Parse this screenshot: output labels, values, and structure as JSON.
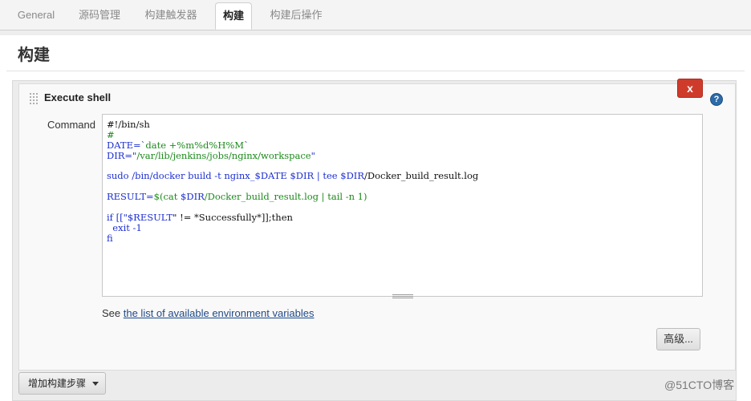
{
  "tabs": [
    {
      "label": "General"
    },
    {
      "label": "源码管理"
    },
    {
      "label": "构建触发器"
    },
    {
      "label": "构建"
    },
    {
      "label": "构建后操作"
    }
  ],
  "section": {
    "title": "构建"
  },
  "build_step": {
    "title": "Execute shell",
    "delete_label": "x",
    "help_label": "?",
    "command_label": "Command",
    "code": [
      "#!/bin/sh",
      "#",
      [
        "DATE=`",
        "date +%m%d%H%M",
        "`"
      ],
      [
        "DIR=\"",
        "/var/lib/jenkins/jobs/nginx/workspace",
        "\""
      ],
      [
        "sudo /bin/docker build -t nginx_",
        "$DATE",
        " ",
        "$DIR",
        " | tee ",
        "$DIR",
        "/Docker_build_result.log"
      ],
      [
        "RESULT=",
        "$(cat ",
        "$DIR",
        "/Docker_build_result.log | tail -n 1)"
      ],
      [
        "if [[\"",
        "$RESULT",
        "\" != *Successfully*]];then"
      ],
      "  exit -1",
      "fi"
    ],
    "env_note_prefix": "See ",
    "env_link": "the list of available environment variables",
    "advanced_label": "高级..."
  },
  "add_step_label": "增加构建步骤",
  "watermark": "@51CTO博客",
  "colors": {
    "accent_delete": "#cf3b2b",
    "help_icon": "#2c6aa8",
    "link": "#204a87"
  }
}
